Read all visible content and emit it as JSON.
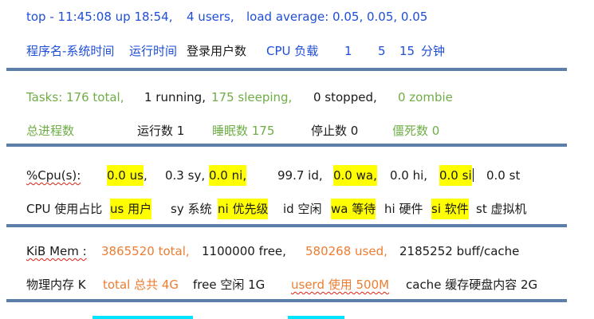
{
  "row1": {
    "top_label": "top - 11:45:08 up 18:54,",
    "users": "4 users,",
    "load": "load average: 0.05, 0.05, 0.05"
  },
  "row2": {
    "prog": "程序名-系统时间",
    "runtime": "运行时间",
    "login_users": "登录用户数",
    "cpu_load": "CPU 负载",
    "one": "1",
    "five": "5",
    "fifteen": "15",
    "minutes": "分钟"
  },
  "tasks": {
    "total": "Tasks: 176 total,",
    "running": "1 running,",
    "sleeping": "175 sleeping,",
    "stopped": "0 stopped,",
    "zombie": "0 zombie"
  },
  "tasks_cn": {
    "total": "总进程数",
    "running": "运行数 1",
    "sleeping": "睡眠数 175",
    "stopped": "停止数 0",
    "zombie": "僵死数 0"
  },
  "cpu": {
    "label": "%Cpu(s):",
    "us": "0.0 us",
    "sy": "0.3 sy,",
    "ni": "0.0 ni",
    "id": "99.7 id,",
    "wa": "0.0 wa",
    "hi": "0.0 hi,",
    "si": "0.0 si",
    "st": "0.0 st"
  },
  "cpu_cn": {
    "label": "CPU 使用占比",
    "us": "us 用户",
    "sy": "sy 系统",
    "ni": "ni 优先级",
    "id": "id 空闲",
    "wa": "wa 等待",
    "hi": "hi 硬件",
    "si": "si 软件",
    "st": "st 虚拟机"
  },
  "mem": {
    "label": "KiB Mem :",
    "total": "3865520 total,",
    "free": "1100000 free,",
    "used": "580268 used,",
    "cache": "2185252 buff/cache"
  },
  "mem_cn": {
    "label": "物理内存 K",
    "total": "total 总共 4G",
    "free": "free 空闲 1G",
    "used": "userd 使用 500M",
    "cache": "cache 缓存硬盘内容 2G"
  },
  "colors": {
    "blue": "#1f4ed8",
    "green": "#70ad47",
    "orange": "#ed7d31",
    "highlight": "#ffff00",
    "rule": "#5b7fa9",
    "cyan": "#00e5ff"
  }
}
